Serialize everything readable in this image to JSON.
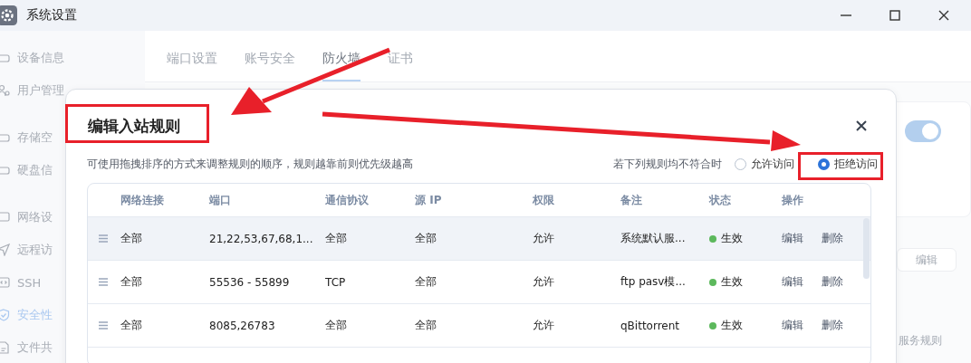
{
  "window": {
    "title": "系统设置"
  },
  "sidebar": {
    "items": [
      {
        "label": "设备信息",
        "selected": false
      },
      {
        "label": "用户管理",
        "selected": false
      },
      {
        "label": "存储空",
        "selected": false
      },
      {
        "label": "硬盘信",
        "selected": false
      },
      {
        "label": "网络设",
        "selected": false
      },
      {
        "label": "远程访",
        "selected": false
      },
      {
        "label": "SSH",
        "selected": false
      },
      {
        "label": "安全性",
        "selected": true
      },
      {
        "label": "文件共",
        "selected": false
      }
    ]
  },
  "tabs": [
    {
      "label": "端口设置",
      "selected": false
    },
    {
      "label": "账号安全",
      "selected": false
    },
    {
      "label": "防火墙",
      "selected": true
    },
    {
      "label": "证书",
      "selected": false
    }
  ],
  "background_panel": {
    "toggle_on": true,
    "edit_button": "编辑",
    "text": "服务规则"
  },
  "dialog": {
    "title": "编辑入站规则",
    "description": "可使用拖拽排序的方式来调整规则的顺序，规则越靠前则优先级越高",
    "default_label": "若下列规则均不符合时",
    "options": [
      {
        "label": "允许访问",
        "selected": false
      },
      {
        "label": "拒绝访问",
        "selected": true
      }
    ],
    "table": {
      "columns": [
        "网络连接",
        "端口",
        "通信协议",
        "源 IP",
        "权限",
        "备注",
        "状态",
        "操作"
      ],
      "rows": [
        {
          "selected": true,
          "cells": [
            "全部",
            "21,22,53,67,68,1...",
            "全部",
            "全部",
            "允许",
            "系统默认服..."
          ],
          "status": "生效",
          "color": "#5cb85c",
          "actions": [
            "编辑",
            "删除"
          ]
        },
        {
          "selected": false,
          "cells": [
            "全部",
            "55536 - 55899",
            "TCP",
            "全部",
            "允许",
            "ftp pasv模..."
          ],
          "status": "生效",
          "color": "#5cb85c",
          "actions": [
            "编辑",
            "删除"
          ]
        },
        {
          "selected": false,
          "cells": [
            "全部",
            "8085,26783",
            "全部",
            "全部",
            "允许",
            "qBittorrent"
          ],
          "status": "生效",
          "color": "#5cb85c",
          "actions": [
            "编辑",
            "删除"
          ]
        }
      ]
    }
  }
}
